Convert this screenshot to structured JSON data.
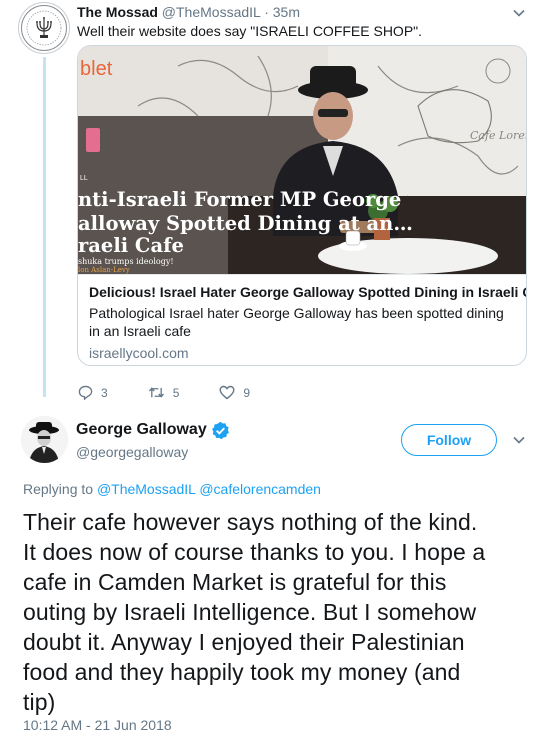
{
  "parent_tweet": {
    "display_name": "The Mossad",
    "handle": "@TheMossadIL",
    "separator": "·",
    "time": "35m",
    "text": "Well their website does say \"ISRAELI COFFEE SHOP\".",
    "card": {
      "image_headline_lines": [
        "nti-Israeli Former MP George",
        "alloway Spotted Dining at an…",
        "raeli Cafe"
      ],
      "image_overlay_small": "shuka trumps ideology!",
      "image_overlay_byline": "lon Aslan-Levy",
      "image_overlay_tag": "LL",
      "image_logo_fragment": "blet",
      "image_wall_text": "Cafe Loren",
      "title": "Delicious! Israel Hater George Galloway Spotted Dining in Israeli Cafe",
      "description": "Pathological Israel hater George Galloway has been spotted dining in an Israeli cafe",
      "domain": "israellycool.com"
    },
    "actions": {
      "replies": "3",
      "retweets": "5",
      "likes": "9"
    },
    "avatar_seal_text": "MOSSAD"
  },
  "main_tweet": {
    "display_name": "George Galloway",
    "handle": "@georgegalloway",
    "follow_label": "Follow",
    "replying_prefix": "Replying to",
    "mention_1": "@TheMossadIL",
    "mention_2": "@cafelorencamden",
    "text_lines": [
      "Their cafe however says nothing of the kind.",
      "It does now of course thanks to you. I hope a",
      "cafe in Camden Market is grateful for this",
      "outing by Israeli Intelligence. But I somehow",
      "doubt it. Anyway I enjoyed their Palestinian",
      "food and they happily took my money (and",
      "tip)"
    ],
    "timestamp": "10:12 AM - 21 Jun 2018"
  },
  "colors": {
    "accent": "#1da1f2",
    "muted": "#657786",
    "thread_line": "#c4e3f6",
    "verified": "#1da1f2",
    "headline_red": "#c0392b"
  },
  "icons": [
    "reply-icon",
    "retweet-icon",
    "like-icon",
    "chevron-down-icon",
    "verified-badge-icon"
  ]
}
